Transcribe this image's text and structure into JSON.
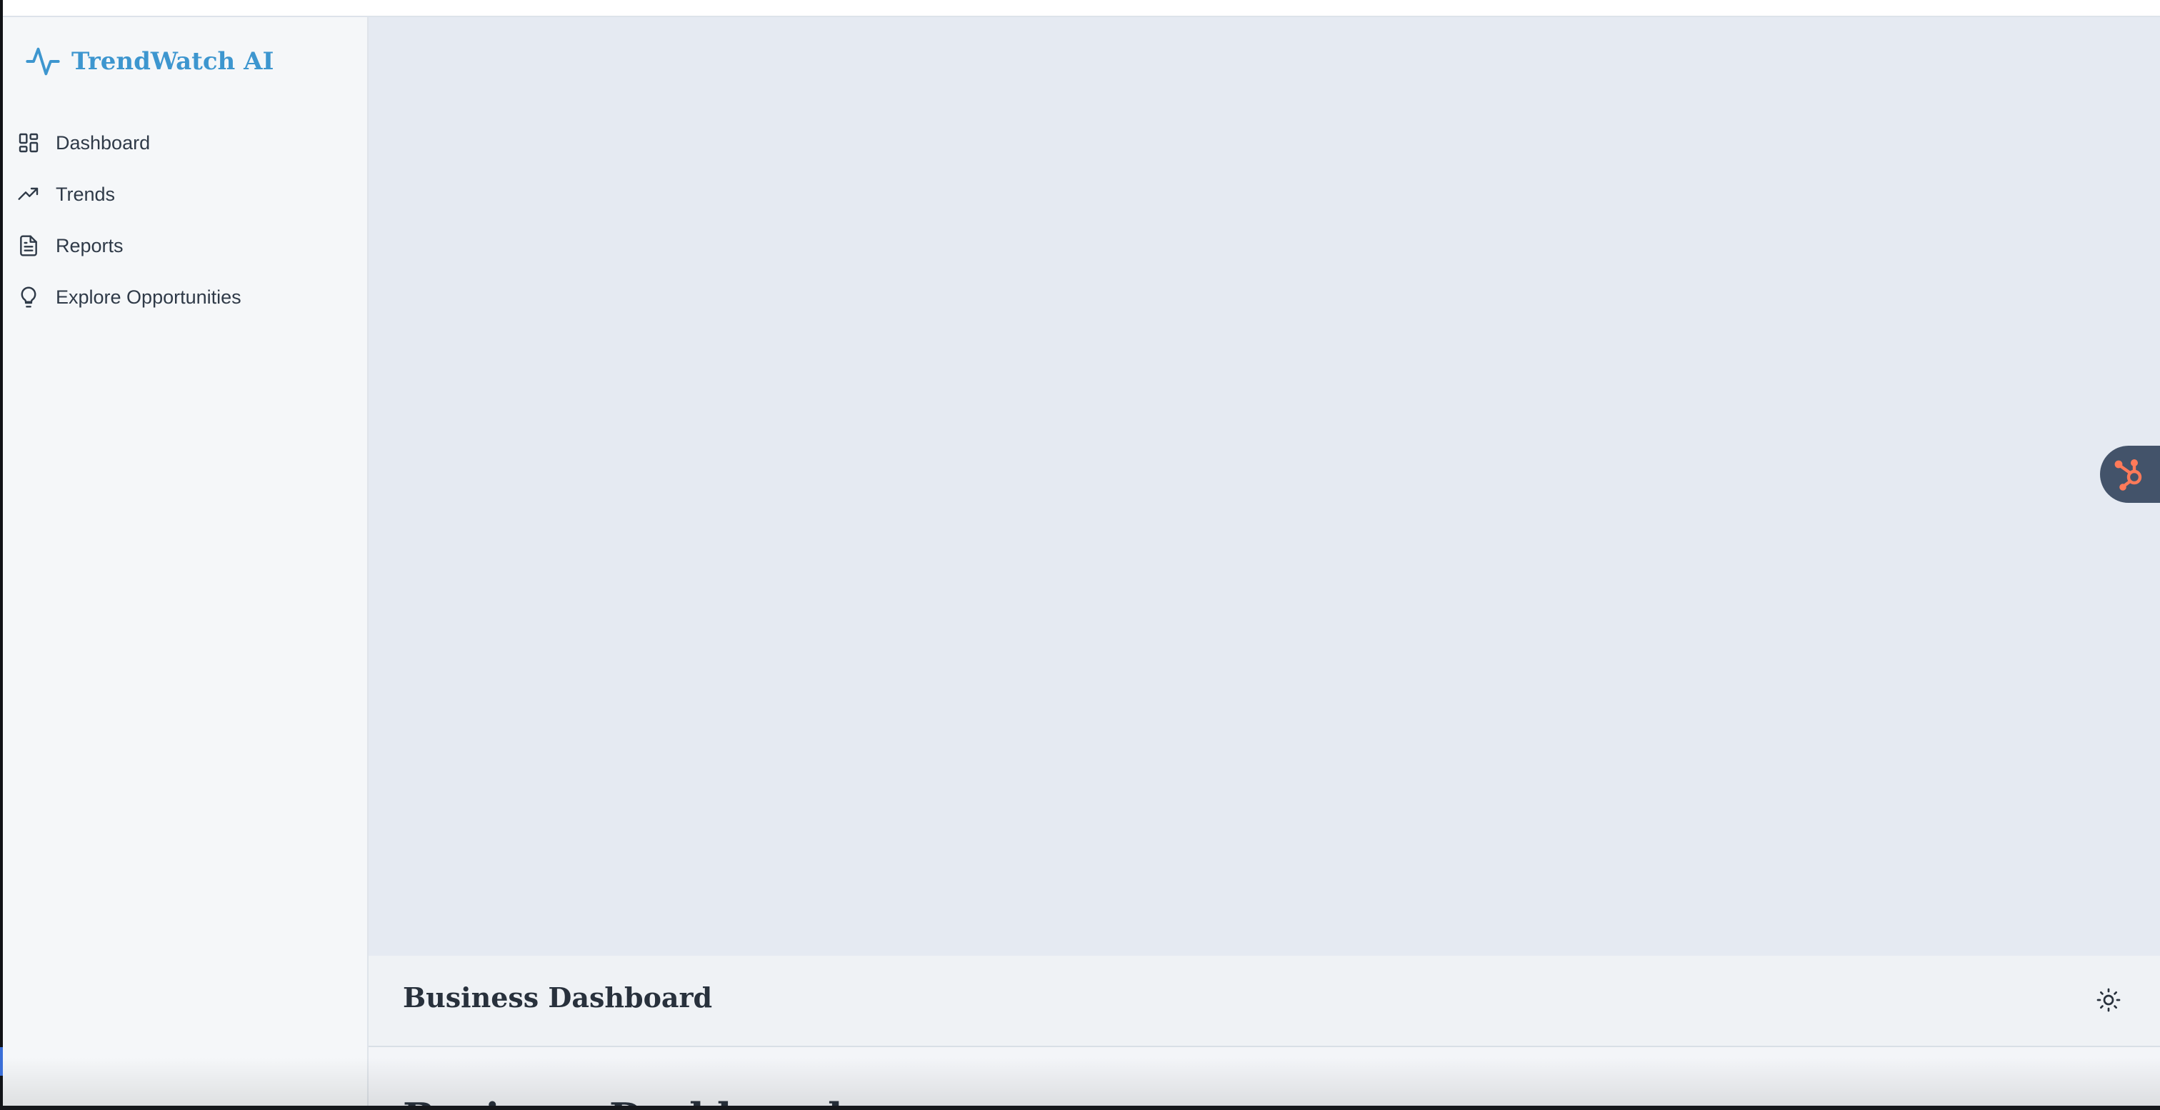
{
  "app": {
    "brand_name": "TrendWatch AI",
    "brand_color": "#3d96cf"
  },
  "sidebar": {
    "items": [
      {
        "label": "Dashboard",
        "icon": "dashboard-grid-icon"
      },
      {
        "label": "Trends",
        "icon": "trending-up-icon"
      },
      {
        "label": "Reports",
        "icon": "document-icon"
      },
      {
        "label": "Explore Opportunities",
        "icon": "lightbulb-icon"
      }
    ]
  },
  "header": {
    "title": "Business Dashboard",
    "theme_toggle_icon": "sun-icon"
  },
  "main": {
    "page_title": "Business Dashboard"
  },
  "widgets": {
    "hubspot_launcher_icon": "hubspot-sprocket-icon",
    "hubspot_color": "#ff7a59"
  }
}
